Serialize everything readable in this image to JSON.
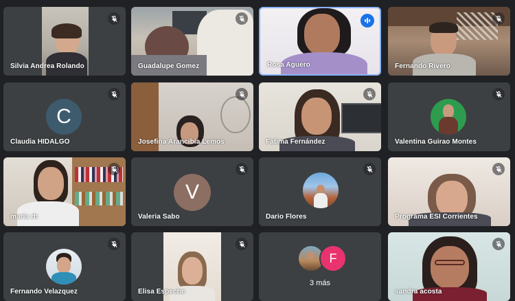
{
  "participants": [
    {
      "name": "Silvia Andrea Rolando",
      "muted": true
    },
    {
      "name": "Guadalupe Gomez",
      "muted": true
    },
    {
      "name": "Rosa Aguero",
      "muted": false,
      "speaking": true
    },
    {
      "name": "Fernando Rivero",
      "muted": true
    },
    {
      "name": "Claudia HIDALGO",
      "muted": true,
      "initial": "C",
      "avatar_color": "#3e5b6e"
    },
    {
      "name": "Josefina Arancibia Lemos",
      "muted": true
    },
    {
      "name": "Fátima Fernández",
      "muted": true
    },
    {
      "name": "Valentina Guirao Montes",
      "muted": true
    },
    {
      "name": "maria rh",
      "muted": true
    },
    {
      "name": "Valeria Sabo",
      "muted": true,
      "initial": "V",
      "avatar_color": "#8d6e63"
    },
    {
      "name": "Dario Flores",
      "muted": true
    },
    {
      "name": "Programa ESI Corrientes",
      "muted": true
    },
    {
      "name": "Fernando Velazquez",
      "muted": true
    },
    {
      "name": "Elisa Espeche",
      "muted": true
    },
    {
      "name": "sandra acosta",
      "muted": true
    }
  ],
  "overflow": {
    "label": "3 más",
    "initial": "F",
    "avatar_color": "#e8336f"
  },
  "colors": {
    "background": "#202124",
    "tile": "#3c4043",
    "active_border": "#8ab4f8",
    "speaking": "#1a73e8"
  }
}
